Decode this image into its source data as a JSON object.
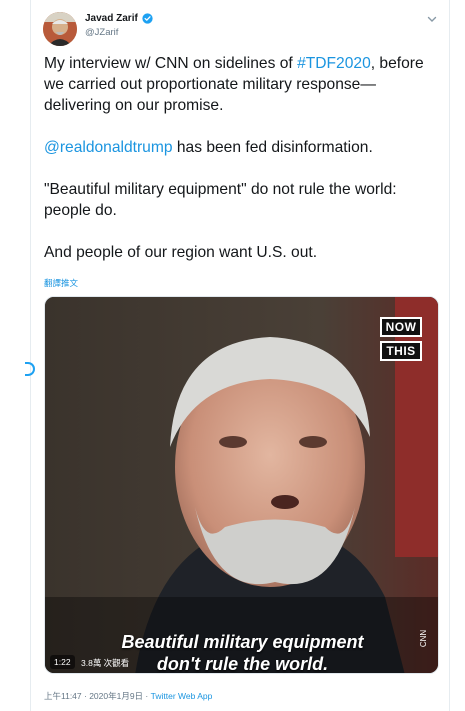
{
  "author": {
    "display_name": "Javad Zarif",
    "handle": "@JZarif"
  },
  "tweet": {
    "paragraphs": [
      {
        "pre": "My interview w/ CNN on sidelines of ",
        "hashtag": "#TDF2020",
        "post": ", before we carried out proportionate military response—delivering on our promise."
      },
      {
        "mention": "@realdonaldtrump",
        "post": " has been fed disinformation."
      },
      {
        "text": "\"Beautiful military equipment\" do not rule the world: people do."
      },
      {
        "text": "And people of our region want U.S. out."
      }
    ],
    "translate_label": "翻譯推文"
  },
  "media": {
    "badge_line1": "NOW",
    "badge_line2": "THIS",
    "caption_line1": "Beautiful military equipment",
    "caption_line2": "don't rule the world.",
    "watermark": "CNN",
    "duration": "1:22",
    "views": "3.8萬 次觀看"
  },
  "meta": {
    "timestamp": "上午11:47 · 2020年1月9日 · ",
    "source": "Twitter Web App"
  },
  "colors": {
    "link": "#1b95e0",
    "verified": "#1da1f2",
    "text": "#14171a",
    "secondary": "#657786"
  }
}
